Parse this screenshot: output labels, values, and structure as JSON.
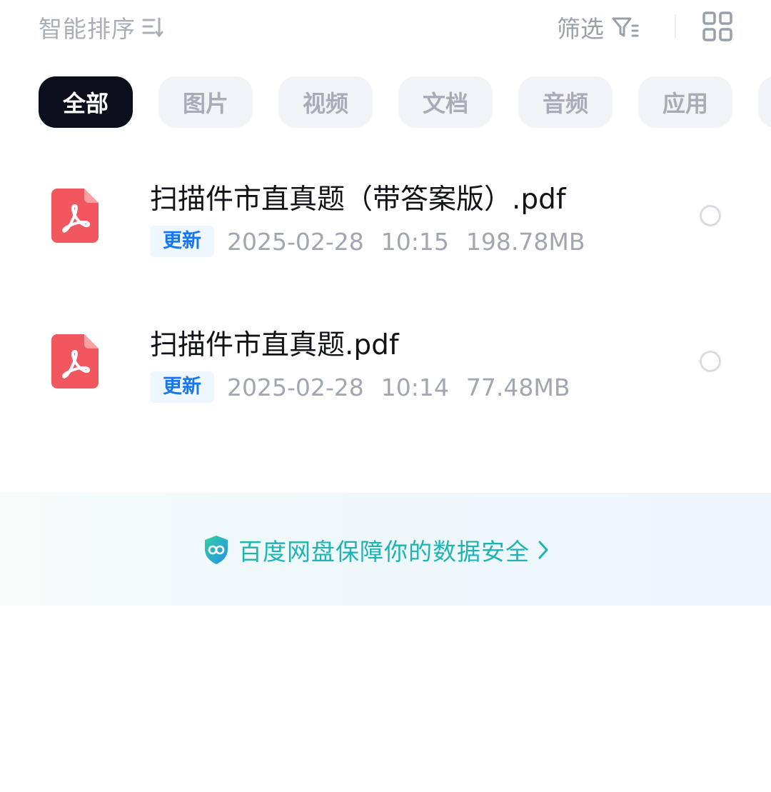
{
  "toolbar": {
    "sort_label": "智能排序",
    "sort_icon": "sort-descending-icon",
    "filter_label": "筛选",
    "filter_icon": "filter-icon",
    "view_icon": "grid-view-icon"
  },
  "categories": {
    "items": [
      {
        "label": "全部",
        "active": true
      },
      {
        "label": "图片",
        "active": false
      },
      {
        "label": "视频",
        "active": false
      },
      {
        "label": "文档",
        "active": false
      },
      {
        "label": "音频",
        "active": false
      },
      {
        "label": "应用",
        "active": false
      }
    ]
  },
  "files": [
    {
      "name": "扫描件市直真题（带答案版）.pdf",
      "badge": "更新",
      "date": "2025-02-28",
      "time": "10:15",
      "size": "198.78MB",
      "icon": "pdf-file-icon",
      "selected": false
    },
    {
      "name": "扫描件市直真题.pdf",
      "badge": "更新",
      "date": "2025-02-28",
      "time": "10:14",
      "size": "77.48MB",
      "icon": "pdf-file-icon",
      "selected": false
    }
  ],
  "banner": {
    "text": "百度网盘保障你的数据安全",
    "icon": "security-shield-icon"
  },
  "colors": {
    "accent_blue": "#1677f2",
    "active_chip": "#0b0f1c",
    "pdf_red": "#f0575f",
    "banner_teal": "#1fb3b3"
  }
}
